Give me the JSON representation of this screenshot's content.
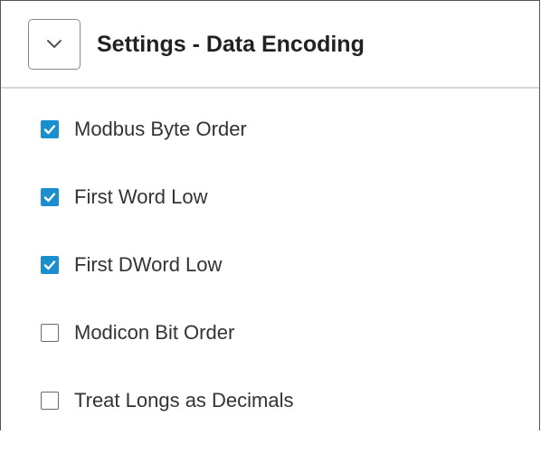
{
  "panel": {
    "title": "Settings - Data Encoding",
    "toggle_icon": "chevron-down-icon"
  },
  "options": [
    {
      "label": "Modbus Byte Order",
      "checked": true
    },
    {
      "label": "First Word Low",
      "checked": true
    },
    {
      "label": "First DWord Low",
      "checked": true
    },
    {
      "label": "Modicon Bit Order",
      "checked": false
    },
    {
      "label": "Treat Longs as Decimals",
      "checked": false
    }
  ],
  "colors": {
    "accent": "#1a8fcf",
    "border": "#555555",
    "divider": "#d6d6d6"
  }
}
